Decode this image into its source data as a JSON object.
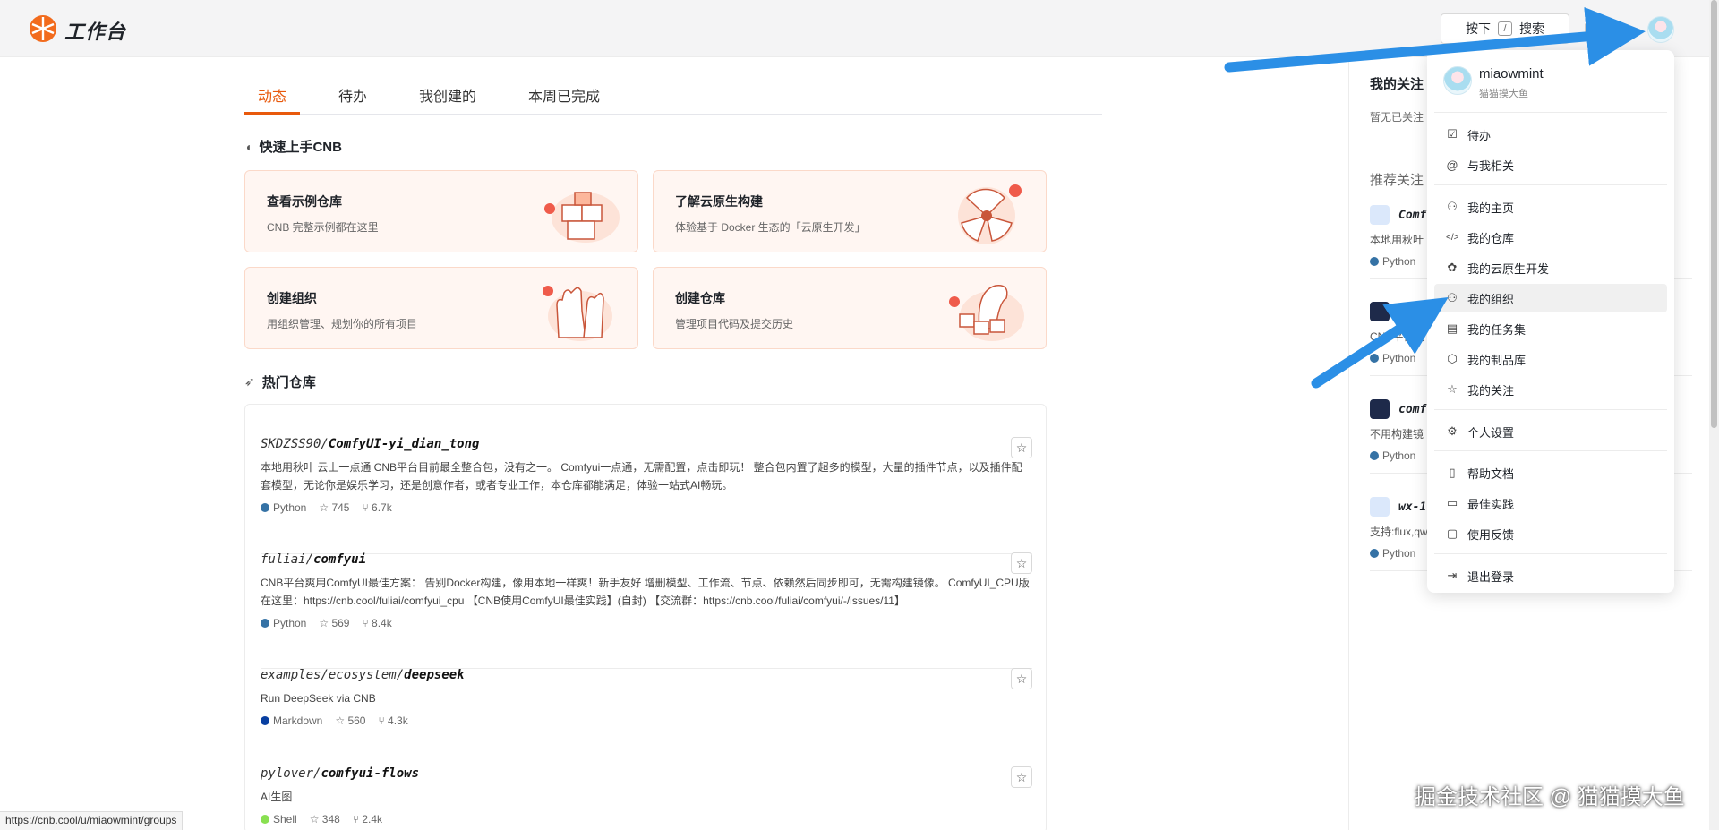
{
  "header": {
    "app_title": "工作台",
    "search_prefix": "按下",
    "search_key": "/",
    "search_label": "搜索"
  },
  "tabs": [
    {
      "label": "动态",
      "active": true
    },
    {
      "label": "待办",
      "active": false
    },
    {
      "label": "我创建的",
      "active": false
    },
    {
      "label": "本周已完成",
      "active": false
    }
  ],
  "quick_start": {
    "title": "快速上手CNB",
    "cards": [
      {
        "title": "查看示例仓库",
        "desc": "CNB 完整示例都在这里"
      },
      {
        "title": "了解云原生构建",
        "desc": "体验基于 Docker 生态的「云原生开发」"
      },
      {
        "title": "创建组织",
        "desc": "用组织管理、规划你的所有项目"
      },
      {
        "title": "创建仓库",
        "desc": "管理项目代码及提交历史"
      }
    ]
  },
  "hot_repos": {
    "title": "热门仓库",
    "items": [
      {
        "owner": "SKDZSS90/",
        "name": "ComfyUI-yi_dian_tong",
        "desc": "本地用秋叶 云上一点通 CNB平台目前最全整合包，没有之一。 Comfyui一点通，无需配置，点击即玩！ 整合包内置了超多的模型，大量的插件节点，以及插件配套模型，无论你是娱乐学习，还是创意作者，或者专业工作，本仓库都能满足，体验一站式AI畅玩。",
        "lang": "Python",
        "lang_color": "#3572a5",
        "stars": "745",
        "forks": "6.7k"
      },
      {
        "owner": "fuliai/",
        "name": "comfyui",
        "desc": "CNB平台爽用ComfyUI最佳方案： 告别Docker构建，像用本地一样爽！新手友好 增删模型、工作流、节点、依赖然后同步即可，无需构建镜像。 ComfyUI_CPU版在这里：https://cnb.cool/fuliai/comfyui_cpu 【CNB使用ComfyUI最佳实践】(自封) 【交流群：https://cnb.cool/fuliai/comfyui/-/issues/11】",
        "lang": "Python",
        "lang_color": "#3572a5",
        "stars": "569",
        "forks": "8.4k"
      },
      {
        "owner": "examples/ecosystem/",
        "name": "deepseek",
        "desc": "Run DeepSeek via CNB",
        "lang": "Markdown",
        "lang_color": "#083fa1",
        "stars": "560",
        "forks": "4.3k"
      },
      {
        "owner": "pylover/",
        "name": "comfyui-flows",
        "desc": "AI生图",
        "lang": "Shell",
        "lang_color": "#89e051",
        "stars": "348",
        "forks": "2.4k"
      }
    ]
  },
  "right_panel": {
    "follow_title": "我的关注",
    "follow_empty": "暂无已关注",
    "recommend_title": "推荐关注",
    "items": [
      {
        "name": "Comf",
        "desc": "本地用秋叶",
        "lang": "Python",
        "icon_color": "#dbe8fb"
      },
      {
        "name": "co",
        "desc": "CNB平台爽",
        "lang": "Python",
        "icon_color": "#1e2a4a"
      },
      {
        "name": "comf",
        "desc": "不用构建镜",
        "lang": "Python",
        "icon_color": "#1e2a4a"
      },
      {
        "name": "wx-1",
        "desc": "支持:flux,qw",
        "lang": "Python",
        "icon_color": "#dbe8fb"
      }
    ]
  },
  "user_menu": {
    "username": "miaowmint",
    "nickname": "猫猫摸大鱼",
    "groups": [
      [
        {
          "label": "待办",
          "icon": "todo-icon",
          "glyph": "☑"
        },
        {
          "label": "与我相关",
          "icon": "at-icon",
          "glyph": "@"
        }
      ],
      [
        {
          "label": "我的主页",
          "icon": "user-icon",
          "glyph": "⚇"
        },
        {
          "label": "我的仓库",
          "icon": "code-icon",
          "glyph": "</>"
        },
        {
          "label": "我的云原生开发",
          "icon": "cloud-dev-icon",
          "glyph": "✿"
        },
        {
          "label": "我的组织",
          "icon": "organization-icon",
          "glyph": "⚇",
          "hover": true
        },
        {
          "label": "我的任务集",
          "icon": "task-list-icon",
          "glyph": "▤"
        },
        {
          "label": "我的制品库",
          "icon": "package-icon",
          "glyph": "⬡"
        },
        {
          "label": "我的关注",
          "icon": "star-icon",
          "glyph": "☆"
        }
      ],
      [
        {
          "label": "个人设置",
          "icon": "settings-icon",
          "glyph": "⚙"
        }
      ],
      [
        {
          "label": "帮助文档",
          "icon": "help-doc-icon",
          "glyph": "▯"
        },
        {
          "label": "最佳实践",
          "icon": "book-icon",
          "glyph": "▭"
        },
        {
          "label": "使用反馈",
          "icon": "feedback-icon",
          "glyph": "▢"
        }
      ],
      [
        {
          "label": "退出登录",
          "icon": "logout-icon",
          "glyph": "⇥"
        }
      ]
    ]
  },
  "status_url": "https://cnb.cool/u/miaowmint/groups",
  "watermark": "掘金技术社区 @ 猫猫摸大鱼",
  "colors": {
    "accent": "#e8590c",
    "arrow": "#2b8fe6"
  }
}
